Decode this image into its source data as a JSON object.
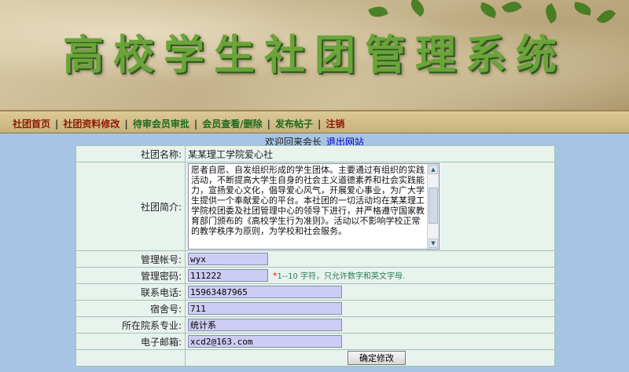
{
  "header": {
    "title": "高校学生社团管理系统"
  },
  "nav": {
    "items": [
      {
        "label": "社团首页"
      },
      {
        "label": "社团资料修改"
      },
      {
        "label": "待审会员审批"
      },
      {
        "label": "会员查看/删除"
      },
      {
        "label": "发布帖子"
      },
      {
        "label": "注销"
      }
    ],
    "separator": "|"
  },
  "welcome": {
    "text": "欢迎回来会长",
    "logout": "退出网站"
  },
  "form": {
    "club_name_label": "社团名称:",
    "club_name": "某某理工学院爱心社",
    "intro_label": "社团简介:",
    "intro_text": "愿者自愿、自发组织形成的学生团体。主要通过有组织的实践活动，不断提高大学生自身的社会主义道德素养和社会实践能力，宣扬爱心文化，倡导爱心风气，开展爱心事业，为广大学生提供一个奉献爱心的平台。本社团的一切活动均在某某理工学院校团委及社团管理中心的领导下进行，并严格遵守国家教育部门颁布的《高校学生行为准则》。活动以不影响学校正常的教学秩序为原则，为学校和社会服务。",
    "account_label": "管理帐号:",
    "account": "wyx",
    "password_label": "管理密码:",
    "password": "111222",
    "password_star": "*",
    "password_hint": "1--10 字符，只允许数字和英文字母.",
    "phone_label": "联系电话:",
    "phone": "15963487965",
    "dorm_label": "宿舍号:",
    "dorm": "711",
    "dept_label": "所在院系专业:",
    "dept": "统计系",
    "email_label": "电子邮箱:",
    "email": "xcd2@163.com",
    "submit_label": "确定修改"
  }
}
